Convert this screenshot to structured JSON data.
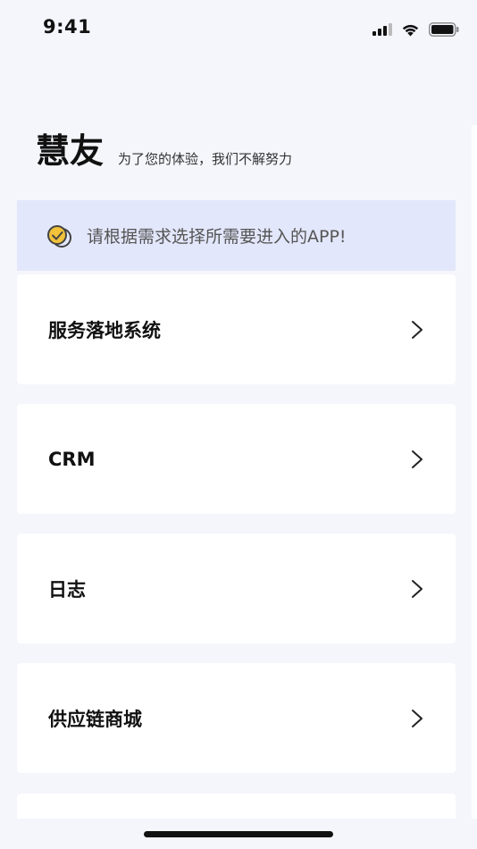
{
  "status_bar": {
    "time": "9:41",
    "icons": [
      "cellular-signal-icon",
      "wifi-icon",
      "battery-icon"
    ]
  },
  "header": {
    "app_name": "慧友",
    "tagline": "为了您的体验，我们不解努力"
  },
  "notice": {
    "icon": "check-badge-icon",
    "text": "请根据需求选择所需要进入的APP!",
    "background": "#e3e7fb"
  },
  "apps": [
    {
      "label": "服务落地系统"
    },
    {
      "label": "CRM"
    },
    {
      "label": "日志"
    },
    {
      "label": "供应链商城"
    },
    {
      "label": ""
    }
  ],
  "colors": {
    "page_background": "#f5f6fc",
    "card_background": "#ffffff",
    "icon_accent": "#f2c23a"
  }
}
